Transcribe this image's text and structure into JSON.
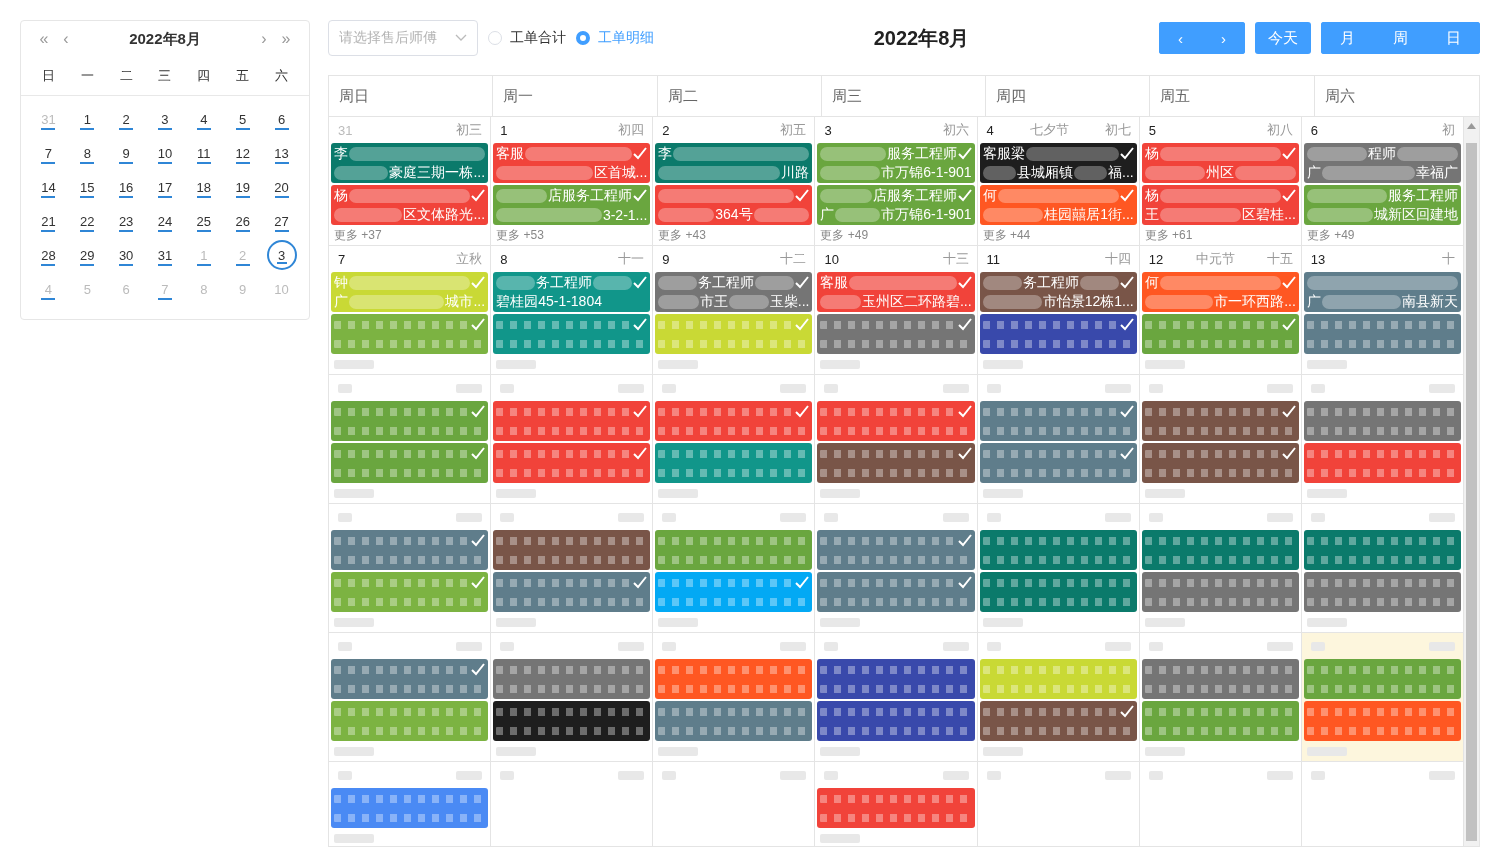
{
  "mini_calendar": {
    "title": "2022年8月",
    "nav": [
      "«",
      "‹",
      "›",
      "»"
    ],
    "weekdays": [
      "日",
      "一",
      "二",
      "三",
      "四",
      "五",
      "六"
    ],
    "days": [
      {
        "label": "31",
        "muted": true,
        "marked": true,
        "selected": false
      },
      {
        "label": "1",
        "muted": false,
        "marked": true,
        "selected": false
      },
      {
        "label": "2",
        "muted": false,
        "marked": true,
        "selected": false
      },
      {
        "label": "3",
        "muted": false,
        "marked": true,
        "selected": false
      },
      {
        "label": "4",
        "muted": false,
        "marked": true,
        "selected": false
      },
      {
        "label": "5",
        "muted": false,
        "marked": true,
        "selected": false
      },
      {
        "label": "6",
        "muted": false,
        "marked": true,
        "selected": false
      },
      {
        "label": "7",
        "muted": false,
        "marked": true,
        "selected": false
      },
      {
        "label": "8",
        "muted": false,
        "marked": true,
        "selected": false
      },
      {
        "label": "9",
        "muted": false,
        "marked": true,
        "selected": false
      },
      {
        "label": "10",
        "muted": false,
        "marked": true,
        "selected": false
      },
      {
        "label": "11",
        "muted": false,
        "marked": true,
        "selected": false
      },
      {
        "label": "12",
        "muted": false,
        "marked": true,
        "selected": false
      },
      {
        "label": "13",
        "muted": false,
        "marked": true,
        "selected": false
      },
      {
        "label": "14",
        "muted": false,
        "marked": true,
        "selected": false
      },
      {
        "label": "15",
        "muted": false,
        "marked": true,
        "selected": false
      },
      {
        "label": "16",
        "muted": false,
        "marked": true,
        "selected": false
      },
      {
        "label": "17",
        "muted": false,
        "marked": true,
        "selected": false
      },
      {
        "label": "18",
        "muted": false,
        "marked": true,
        "selected": false
      },
      {
        "label": "19",
        "muted": false,
        "marked": true,
        "selected": false
      },
      {
        "label": "20",
        "muted": false,
        "marked": true,
        "selected": false
      },
      {
        "label": "21",
        "muted": false,
        "marked": true,
        "selected": false
      },
      {
        "label": "22",
        "muted": false,
        "marked": true,
        "selected": false
      },
      {
        "label": "23",
        "muted": false,
        "marked": true,
        "selected": false
      },
      {
        "label": "24",
        "muted": false,
        "marked": true,
        "selected": false
      },
      {
        "label": "25",
        "muted": false,
        "marked": true,
        "selected": false
      },
      {
        "label": "26",
        "muted": false,
        "marked": true,
        "selected": false
      },
      {
        "label": "27",
        "muted": false,
        "marked": true,
        "selected": false
      },
      {
        "label": "28",
        "muted": false,
        "marked": true,
        "selected": false
      },
      {
        "label": "29",
        "muted": false,
        "marked": true,
        "selected": false
      },
      {
        "label": "30",
        "muted": false,
        "marked": true,
        "selected": false
      },
      {
        "label": "31",
        "muted": false,
        "marked": true,
        "selected": false
      },
      {
        "label": "1",
        "muted": true,
        "marked": true,
        "selected": false
      },
      {
        "label": "2",
        "muted": true,
        "marked": true,
        "selected": false
      },
      {
        "label": "3",
        "muted": false,
        "marked": true,
        "selected": true
      },
      {
        "label": "4",
        "muted": true,
        "marked": true,
        "selected": false
      },
      {
        "label": "5",
        "muted": true,
        "marked": false,
        "selected": false
      },
      {
        "label": "6",
        "muted": true,
        "marked": false,
        "selected": false
      },
      {
        "label": "7",
        "muted": true,
        "marked": true,
        "selected": false
      },
      {
        "label": "8",
        "muted": true,
        "marked": false,
        "selected": false
      },
      {
        "label": "9",
        "muted": true,
        "marked": false,
        "selected": false
      },
      {
        "label": "10",
        "muted": true,
        "marked": false,
        "selected": false
      }
    ]
  },
  "toolbar": {
    "engineer_select": {
      "placeholder": "请选择售后师傅"
    },
    "radios": [
      {
        "label": "工单合计",
        "selected": false
      },
      {
        "label": "工单明细",
        "selected": true
      }
    ],
    "title": "2022年8月",
    "nav_buttons": [
      "‹",
      "›"
    ],
    "today_button": "今天",
    "view_buttons": [
      "月",
      "周",
      "日"
    ]
  },
  "calendar": {
    "weekdays": [
      "周日",
      "周一",
      "周二",
      "周三",
      "周四",
      "周五",
      "周六"
    ],
    "weeks": [
      {
        "days": [
          {
            "kind": "text",
            "date": "31",
            "muted": true,
            "lunar": "初三",
            "more": "更多 +37",
            "events": [
              {
                "kind": "text",
                "color": "#0b7a6b",
                "checked": false,
                "lines": [
                  [
                    {
                      "kind": "text",
                      "text": "李"
                    },
                    {
                      "kind": "blur"
                    }
                  ],
                  [
                    {
                      "kind": "blur"
                    },
                    {
                      "kind": "text",
                      "text": "豪庭三期一栋..."
                    }
                  ]
                ]
              },
              {
                "kind": "text",
                "color": "#f1433a",
                "checked": true,
                "lines": [
                  [
                    {
                      "kind": "text",
                      "text": "杨"
                    },
                    {
                      "kind": "blur"
                    }
                  ],
                  [
                    {
                      "kind": "blur"
                    },
                    {
                      "kind": "text",
                      "text": "区文体路光..."
                    }
                  ]
                ]
              }
            ]
          },
          {
            "kind": "text",
            "date": "1",
            "muted": false,
            "lunar": "初四",
            "more": "更多 +53",
            "events": [
              {
                "kind": "text",
                "color": "#f1433a",
                "checked": true,
                "lines": [
                  [
                    {
                      "kind": "text",
                      "text": "客服"
                    },
                    {
                      "kind": "blur"
                    }
                  ],
                  [
                    {
                      "kind": "blur"
                    },
                    {
                      "kind": "text",
                      "text": "区首城..."
                    }
                  ]
                ]
              },
              {
                "kind": "text",
                "color": "#6aa63f",
                "checked": true,
                "lines": [
                  [
                    {
                      "kind": "blur"
                    },
                    {
                      "kind": "text",
                      "text": "店服务工程师"
                    }
                  ],
                  [
                    {
                      "kind": "blur"
                    },
                    {
                      "kind": "text",
                      "text": "3-2-1..."
                    }
                  ]
                ]
              }
            ]
          },
          {
            "kind": "text",
            "date": "2",
            "muted": false,
            "lunar": "初五",
            "more": "更多 +43",
            "events": [
              {
                "kind": "text",
                "color": "#0b7a6b",
                "checked": false,
                "lines": [
                  [
                    {
                      "kind": "text",
                      "text": "李"
                    },
                    {
                      "kind": "blur"
                    }
                  ],
                  [
                    {
                      "kind": "blur"
                    },
                    {
                      "kind": "text",
                      "text": "川路"
                    }
                  ]
                ]
              },
              {
                "kind": "text",
                "color": "#f1433a",
                "checked": true,
                "lines": [
                  [
                    {
                      "kind": "blur"
                    }
                  ],
                  [
                    {
                      "kind": "blur"
                    },
                    {
                      "kind": "text",
                      "text": "364号"
                    },
                    {
                      "kind": "blur"
                    }
                  ]
                ]
              }
            ]
          },
          {
            "kind": "text",
            "date": "3",
            "muted": false,
            "lunar": "初六",
            "more": "更多 +49",
            "events": [
              {
                "kind": "text",
                "color": "#6aa63f",
                "checked": true,
                "lines": [
                  [
                    {
                      "kind": "blur"
                    },
                    {
                      "kind": "text",
                      "text": "服务工程师"
                    }
                  ],
                  [
                    {
                      "kind": "blur"
                    },
                    {
                      "kind": "text",
                      "text": "市万锦6-1-901"
                    }
                  ]
                ]
              },
              {
                "kind": "text",
                "color": "#6aa63f",
                "checked": true,
                "lines": [
                  [
                    {
                      "kind": "blur"
                    },
                    {
                      "kind": "text",
                      "text": "店服务工程师"
                    }
                  ],
                  [
                    {
                      "kind": "text",
                      "text": "广"
                    },
                    {
                      "kind": "blur"
                    },
                    {
                      "kind": "text",
                      "text": "市万锦6-1-901"
                    }
                  ]
                ]
              }
            ]
          },
          {
            "kind": "text",
            "date": "4",
            "muted": false,
            "festival": "七夕节",
            "lunar": "初七",
            "more": "更多 +44",
            "events": [
              {
                "kind": "text",
                "color": "#1e1e1e",
                "checked": true,
                "lines": [
                  [
                    {
                      "kind": "text",
                      "text": "客服梁"
                    },
                    {
                      "kind": "blur"
                    }
                  ],
                  [
                    {
                      "kind": "blur"
                    },
                    {
                      "kind": "text",
                      "text": "县城厢镇"
                    },
                    {
                      "kind": "blur"
                    },
                    {
                      "kind": "text",
                      "text": "福..."
                    }
                  ]
                ]
              },
              {
                "kind": "text",
                "color": "#ff5722",
                "checked": true,
                "lines": [
                  [
                    {
                      "kind": "text",
                      "text": "何"
                    },
                    {
                      "kind": "blur"
                    }
                  ],
                  [
                    {
                      "kind": "blur"
                    },
                    {
                      "kind": "text",
                      "text": "桂园囍居1街..."
                    }
                  ]
                ]
              }
            ]
          },
          {
            "kind": "text",
            "date": "5",
            "muted": false,
            "lunar": "初八",
            "more": "更多 +61",
            "events": [
              {
                "kind": "text",
                "color": "#f1433a",
                "checked": true,
                "lines": [
                  [
                    {
                      "kind": "text",
                      "text": "杨"
                    },
                    {
                      "kind": "blur"
                    }
                  ],
                  [
                    {
                      "kind": "blur"
                    },
                    {
                      "kind": "text",
                      "text": "州区"
                    },
                    {
                      "kind": "blur"
                    }
                  ]
                ]
              },
              {
                "kind": "text",
                "color": "#f1433a",
                "checked": true,
                "lines": [
                  [
                    {
                      "kind": "text",
                      "text": "杨"
                    },
                    {
                      "kind": "blur"
                    }
                  ],
                  [
                    {
                      "kind": "text",
                      "text": "王"
                    },
                    {
                      "kind": "blur"
                    },
                    {
                      "kind": "text",
                      "text": "区碧桂..."
                    }
                  ]
                ]
              }
            ]
          },
          {
            "kind": "text",
            "date": "6",
            "muted": false,
            "lunar": "初",
            "more": "更多 +49",
            "events": [
              {
                "kind": "text",
                "color": "#757575",
                "checked": false,
                "lines": [
                  [
                    {
                      "kind": "blur"
                    },
                    {
                      "kind": "text",
                      "text": "程师"
                    },
                    {
                      "kind": "blur"
                    }
                  ],
                  [
                    {
                      "kind": "text",
                      "text": "广"
                    },
                    {
                      "kind": "blur"
                    },
                    {
                      "kind": "text",
                      "text": "幸福广"
                    }
                  ]
                ]
              },
              {
                "kind": "text",
                "color": "#6aa63f",
                "checked": false,
                "lines": [
                  [
                    {
                      "kind": "blur"
                    },
                    {
                      "kind": "text",
                      "text": "服务工程师"
                    }
                  ],
                  [
                    {
                      "kind": "blur"
                    },
                    {
                      "kind": "text",
                      "text": "城新区回建地"
                    }
                  ]
                ]
              }
            ]
          }
        ]
      },
      {
        "days": [
          {
            "kind": "text",
            "date": "7",
            "muted": false,
            "lunar": "立秋",
            "events": [
              {
                "kind": "text",
                "color": "#c9d935",
                "checked": true,
                "lines": [
                  [
                    {
                      "kind": "text",
                      "text": "钟"
                    },
                    {
                      "kind": "blur"
                    }
                  ],
                  [
                    {
                      "kind": "text",
                      "text": "广"
                    },
                    {
                      "kind": "blur"
                    },
                    {
                      "kind": "text",
                      "text": "城市..."
                    }
                  ]
                ]
              },
              {
                "kind": "blurred",
                "color": "#7cb342",
                "checked": true
              }
            ]
          },
          {
            "kind": "text",
            "date": "8",
            "muted": false,
            "lunar": "十一",
            "events": [
              {
                "kind": "text",
                "color": "#11968a",
                "checked": true,
                "lines": [
                  [
                    {
                      "kind": "blur"
                    },
                    {
                      "kind": "text",
                      "text": "务工程师"
                    },
                    {
                      "kind": "blur"
                    }
                  ],
                  [
                    {
                      "kind": "text",
                      "text": "碧桂园45-1-1804"
                    }
                  ]
                ]
              },
              {
                "kind": "blurred",
                "color": "#11968a",
                "checked": true
              }
            ]
          },
          {
            "kind": "text",
            "date": "9",
            "muted": false,
            "lunar": "十二",
            "events": [
              {
                "kind": "text",
                "color": "#757575",
                "checked": true,
                "lines": [
                  [
                    {
                      "kind": "blur"
                    },
                    {
                      "kind": "text",
                      "text": "务工程师"
                    },
                    {
                      "kind": "blur"
                    }
                  ],
                  [
                    {
                      "kind": "blur"
                    },
                    {
                      "kind": "text",
                      "text": "市王"
                    },
                    {
                      "kind": "blur"
                    },
                    {
                      "kind": "text",
                      "text": "玉柴..."
                    }
                  ]
                ]
              },
              {
                "kind": "blurred",
                "color": "#c9d935",
                "checked": true
              }
            ]
          },
          {
            "kind": "text",
            "date": "10",
            "muted": false,
            "lunar": "十三",
            "events": [
              {
                "kind": "text",
                "color": "#f1433a",
                "checked": true,
                "lines": [
                  [
                    {
                      "kind": "text",
                      "text": "客服"
                    },
                    {
                      "kind": "blur"
                    }
                  ],
                  [
                    {
                      "kind": "blur"
                    },
                    {
                      "kind": "text",
                      "text": "玉州区二环路碧..."
                    }
                  ]
                ]
              },
              {
                "kind": "blurred",
                "color": "#757575",
                "checked": true
              }
            ]
          },
          {
            "kind": "text",
            "date": "11",
            "muted": false,
            "lunar": "十四",
            "events": [
              {
                "kind": "text",
                "color": "#795548",
                "checked": true,
                "lines": [
                  [
                    {
                      "kind": "blur"
                    },
                    {
                      "kind": "text",
                      "text": "务工程师"
                    },
                    {
                      "kind": "blur"
                    }
                  ],
                  [
                    {
                      "kind": "blur"
                    },
                    {
                      "kind": "text",
                      "text": "市怡景12栋1..."
                    }
                  ]
                ]
              },
              {
                "kind": "blurred",
                "color": "#3949ab",
                "checked": true
              }
            ]
          },
          {
            "kind": "text",
            "date": "12",
            "muted": false,
            "festival": "中元节",
            "lunar": "十五",
            "events": [
              {
                "kind": "text",
                "color": "#ff5722",
                "checked": true,
                "lines": [
                  [
                    {
                      "kind": "text",
                      "text": "何"
                    },
                    {
                      "kind": "blur"
                    }
                  ],
                  [
                    {
                      "kind": "blur"
                    },
                    {
                      "kind": "text",
                      "text": "市一环西路..."
                    }
                  ]
                ]
              },
              {
                "kind": "blurred",
                "color": "#6aa63f",
                "checked": true
              }
            ]
          },
          {
            "kind": "text",
            "date": "13",
            "muted": false,
            "lunar": "十",
            "events": [
              {
                "kind": "text",
                "color": "#5f7d8b",
                "checked": false,
                "lines": [
                  [
                    {
                      "kind": "blur"
                    }
                  ],
                  [
                    {
                      "kind": "text",
                      "text": "广"
                    },
                    {
                      "kind": "blur"
                    },
                    {
                      "kind": "text",
                      "text": "南县新天"
                    }
                  ]
                ]
              },
              {
                "kind": "blurred",
                "color": "#5f7d8b",
                "checked": false
              }
            ]
          }
        ]
      },
      {
        "days": [
          {
            "kind": "blurred",
            "events": [
              {
                "kind": "blurred",
                "color": "#6aa63f",
                "checked": true
              },
              {
                "kind": "blurred",
                "color": "#6aa63f",
                "checked": true
              }
            ]
          },
          {
            "kind": "blurred",
            "events": [
              {
                "kind": "blurred",
                "color": "#f1433a",
                "checked": true
              },
              {
                "kind": "blurred",
                "color": "#f1433a",
                "checked": true
              }
            ]
          },
          {
            "kind": "blurred",
            "events": [
              {
                "kind": "blurred",
                "color": "#f1433a",
                "checked": true
              },
              {
                "kind": "blurred",
                "color": "#11968a",
                "checked": false
              }
            ]
          },
          {
            "kind": "blurred",
            "events": [
              {
                "kind": "blurred",
                "color": "#f1433a",
                "checked": true
              },
              {
                "kind": "blurred",
                "color": "#795548",
                "checked": true
              }
            ]
          },
          {
            "kind": "blurred",
            "events": [
              {
                "kind": "blurred",
                "color": "#5f7d8b",
                "checked": true
              },
              {
                "kind": "blurred",
                "color": "#5f7d8b",
                "checked": true
              }
            ]
          },
          {
            "kind": "blurred",
            "events": [
              {
                "kind": "blurred",
                "color": "#795548",
                "checked": true
              },
              {
                "kind": "blurred",
                "color": "#795548",
                "checked": true
              }
            ]
          },
          {
            "kind": "blurred",
            "events": [
              {
                "kind": "blurred",
                "color": "#757575",
                "checked": false
              },
              {
                "kind": "blurred",
                "color": "#f1433a",
                "checked": false
              }
            ]
          }
        ]
      },
      {
        "days": [
          {
            "kind": "blurred",
            "events": [
              {
                "kind": "blurred",
                "color": "#5f7d8b",
                "checked": true
              },
              {
                "kind": "blurred",
                "color": "#7cb342",
                "checked": true
              }
            ]
          },
          {
            "kind": "blurred",
            "events": [
              {
                "kind": "blurred",
                "color": "#795548",
                "checked": false
              },
              {
                "kind": "blurred",
                "color": "#5f7d8b",
                "checked": true
              }
            ]
          },
          {
            "kind": "blurred",
            "events": [
              {
                "kind": "blurred",
                "color": "#6aa63f",
                "checked": false
              },
              {
                "kind": "blurred",
                "color": "#03a9f4",
                "checked": true
              }
            ]
          },
          {
            "kind": "blurred",
            "events": [
              {
                "kind": "blurred",
                "color": "#5f7d8b",
                "checked": true
              },
              {
                "kind": "blurred",
                "color": "#5f7d8b",
                "checked": true
              }
            ]
          },
          {
            "kind": "blurred",
            "events": [
              {
                "kind": "blurred",
                "color": "#0b7a6b",
                "checked": false
              },
              {
                "kind": "blurred",
                "color": "#0b7a6b",
                "checked": false
              }
            ]
          },
          {
            "kind": "blurred",
            "events": [
              {
                "kind": "blurred",
                "color": "#0b7a6b",
                "checked": false
              },
              {
                "kind": "blurred",
                "color": "#757575",
                "checked": false
              }
            ]
          },
          {
            "kind": "blurred",
            "events": [
              {
                "kind": "blurred",
                "color": "#0b7a6b",
                "checked": false
              },
              {
                "kind": "blurred",
                "color": "#757575",
                "checked": false
              }
            ]
          }
        ]
      },
      {
        "days": [
          {
            "kind": "blurred",
            "events": [
              {
                "kind": "blurred",
                "color": "#5f7d8b",
                "checked": true
              },
              {
                "kind": "blurred",
                "color": "#7cb342",
                "checked": false
              }
            ]
          },
          {
            "kind": "blurred",
            "events": [
              {
                "kind": "blurred",
                "color": "#757575",
                "checked": false
              },
              {
                "kind": "blurred",
                "color": "#1e1e1e",
                "checked": false
              }
            ]
          },
          {
            "kind": "blurred",
            "events": [
              {
                "kind": "blurred",
                "color": "#ff5722",
                "checked": false
              },
              {
                "kind": "blurred",
                "color": "#5f7d8b",
                "checked": false
              }
            ]
          },
          {
            "kind": "blurred",
            "events": [
              {
                "kind": "blurred",
                "color": "#3949ab",
                "checked": false
              },
              {
                "kind": "blurred",
                "color": "#3949ab",
                "checked": false
              }
            ]
          },
          {
            "kind": "blurred",
            "events": [
              {
                "kind": "blurred",
                "color": "#c9d935",
                "checked": false
              },
              {
                "kind": "blurred",
                "color": "#795548",
                "checked": true
              }
            ]
          },
          {
            "kind": "blurred",
            "events": [
              {
                "kind": "blurred",
                "color": "#757575",
                "checked": false
              },
              {
                "kind": "blurred",
                "color": "#6aa63f",
                "checked": false
              }
            ]
          },
          {
            "kind": "blurred",
            "today": true,
            "events": [
              {
                "kind": "blurred",
                "color": "#6aa63f",
                "checked": false
              },
              {
                "kind": "blurred",
                "color": "#ff5722",
                "checked": false
              }
            ]
          }
        ]
      },
      {
        "days": [
          {
            "kind": "blurred",
            "events": [
              {
                "kind": "blurred",
                "color": "#4a8af4",
                "checked": false
              }
            ]
          },
          {
            "kind": "blurred"
          },
          {
            "kind": "blurred"
          },
          {
            "kind": "blurred",
            "events": [
              {
                "kind": "blurred",
                "color": "#f1433a",
                "checked": false
              }
            ]
          },
          {
            "kind": "blurred"
          },
          {
            "kind": "blurred"
          },
          {
            "kind": "blurred"
          }
        ]
      }
    ]
  }
}
